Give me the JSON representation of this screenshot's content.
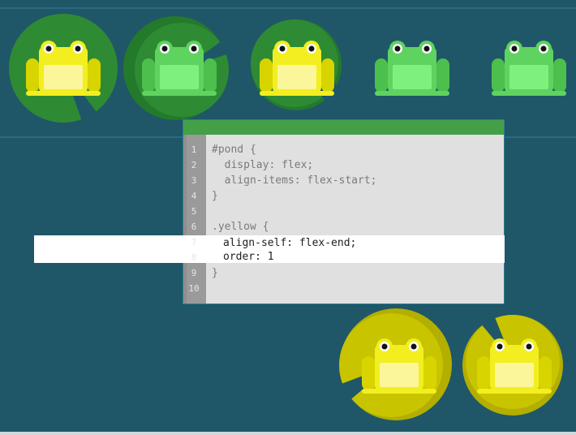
{
  "colors": {
    "background": "#1f5768",
    "green_pad": "#2e8b34",
    "green_pad_shadow": "#237a2b",
    "yellow_pad": "#c9c400",
    "yellow_pad_shadow": "#b3ae00",
    "green_frog": "#5fd35f",
    "yellow_frog": "#f2ee20",
    "editor_header": "#43a047",
    "editor_bg": "#e0e0e0",
    "gutter": "#999999"
  },
  "icons": {
    "lily_pad": "lily-pad-icon",
    "frog": "frog-icon"
  },
  "editor": {
    "line_numbers": [
      "1",
      "2",
      "3",
      "4",
      "5",
      "6",
      "7",
      "8",
      "9",
      "10"
    ],
    "lines": [
      "#pond {",
      "  display: flex;",
      "  align-items: flex-start;",
      "}",
      "",
      ".yellow {",
      "",
      "",
      "}",
      ""
    ],
    "input_lines": [
      "align-self: flex-end;",
      "order: 1"
    ]
  }
}
